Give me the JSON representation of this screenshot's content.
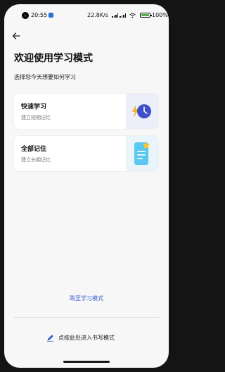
{
  "status_bar": {
    "time": "20:55",
    "network_speed": "22.8K/s",
    "battery": "100"
  },
  "header": {
    "back_icon": "arrow-left-icon",
    "title": "欢迎使用学习模式",
    "subtitle": "选择您今天想要如何学习"
  },
  "options": [
    {
      "title": "快速学习",
      "description": "建立短期记忆",
      "icon": "lightning-clock-icon"
    },
    {
      "title": "全部记住",
      "description": "建立长期记忆",
      "icon": "notepad-star-icon"
    }
  ],
  "footer": {
    "switch_link": "跳至学习模式",
    "write_label": "点按此处进入书写模式",
    "write_icon": "pen-icon"
  },
  "colors": {
    "accent": "#3d63d1",
    "background": "#f7f7f8"
  }
}
